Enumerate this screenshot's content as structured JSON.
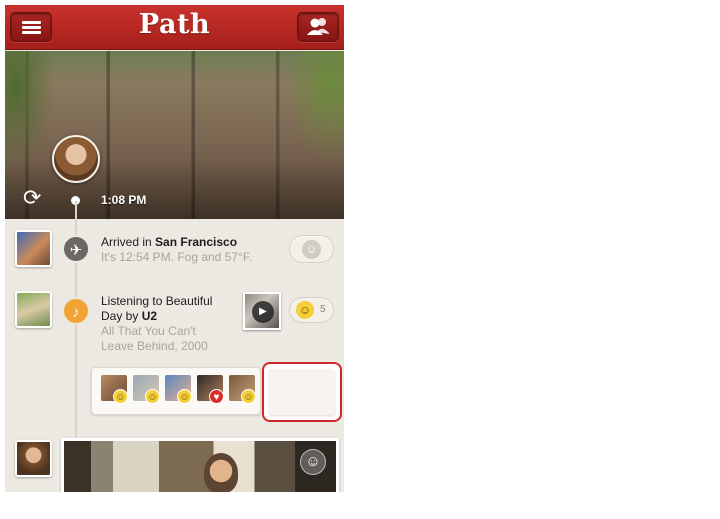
{
  "header": {
    "title": "Path",
    "menu_icon": "menu-icon",
    "friends_icon": "friends-icon"
  },
  "cover": {
    "time": "1:08 PM",
    "refresh_glyph": "⟳"
  },
  "feed": {
    "checkin": {
      "prefix": "Arrived in ",
      "place": "San Francisco",
      "detail": "It's 12:54 PM. Fog and 57°F.",
      "icon": "airplane-icon",
      "icon_glyph": "✈",
      "smiley_glyph": "☺"
    },
    "music": {
      "line1": "Listening to Beautiful",
      "line2_prefix": "Day by ",
      "artist": "U2",
      "album": "All That You Can't Leave Behind, 2000",
      "icon": "music-icon",
      "icon_glyph": "♪",
      "play_glyph": "▶",
      "smiley_glyph": "☺",
      "smiley_count": "5"
    },
    "reactions": [
      {
        "badge": "☺"
      },
      {
        "badge": "☺"
      },
      {
        "badge": "☺"
      },
      {
        "badge": "♥"
      },
      {
        "badge": "☺"
      }
    ],
    "photo": {
      "smiley_glyph": "☺"
    }
  },
  "colors": {
    "brand_red": "#b8231f",
    "highlight_red": "#d0262d",
    "background": "#ece8e2"
  }
}
